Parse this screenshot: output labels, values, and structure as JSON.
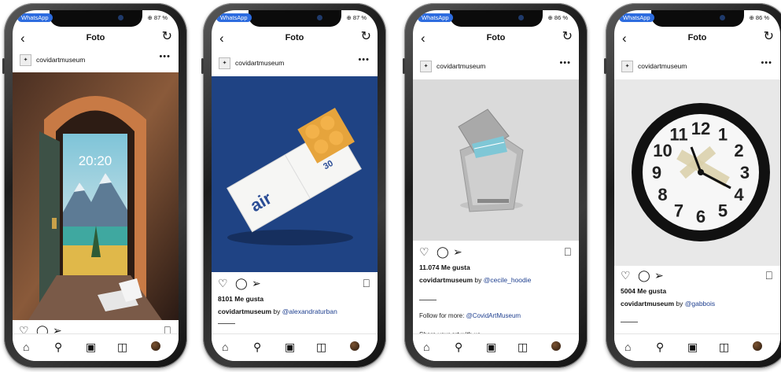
{
  "status": {
    "app_badge": "WhatsApp"
  },
  "phones": [
    {
      "battery": "⊕ 87 %",
      "header_title": "Foto",
      "account": "covidartmuseum",
      "likes": "",
      "caption_user": "",
      "caption_by": "",
      "caption_mention": ""
    },
    {
      "battery": "⊕ 87 %",
      "header_title": "Foto",
      "account": "covidartmuseum",
      "likes": "8101 Me gusta",
      "caption_user": "covidartmuseum",
      "caption_by": " by ",
      "caption_mention": "@alexandraturban"
    },
    {
      "battery": "⊕ 86 %",
      "header_title": "Foto",
      "account": "covidartmuseum",
      "likes": "11.074 Me gusta",
      "caption_user": "covidartmuseum",
      "caption_by": " by ",
      "caption_mention": "@cecile_hoodie",
      "follow_text": "Follow for more: ",
      "follow_mention": "@CovidArtMuseum",
      "share_text": "Share your art with us"
    },
    {
      "battery": "⊕ 86 %",
      "header_title": "Foto",
      "account": "covidartmuseum",
      "likes": "5004 Me gusta",
      "caption_user": "covidartmuseum",
      "caption_by": " by ",
      "caption_mention": "@gabbois"
    }
  ],
  "artwork": {
    "lock_time": "20:20",
    "package_brand": "air",
    "package_count": "30",
    "clock_numbers": [
      "12",
      "1",
      "2",
      "3",
      "4",
      "5",
      "6",
      "7",
      "8",
      "9",
      "10",
      "11"
    ]
  },
  "icons": {
    "back": "chevron-left-icon",
    "refresh": "refresh-icon",
    "more": "more-dots-icon",
    "like": "heart-icon",
    "comment": "comment-icon",
    "share": "send-icon",
    "save": "bookmark-icon",
    "home": "home-icon",
    "search": "search-icon",
    "reels": "reels-icon",
    "shop": "shop-icon",
    "profile": "profile-avatar-icon"
  }
}
